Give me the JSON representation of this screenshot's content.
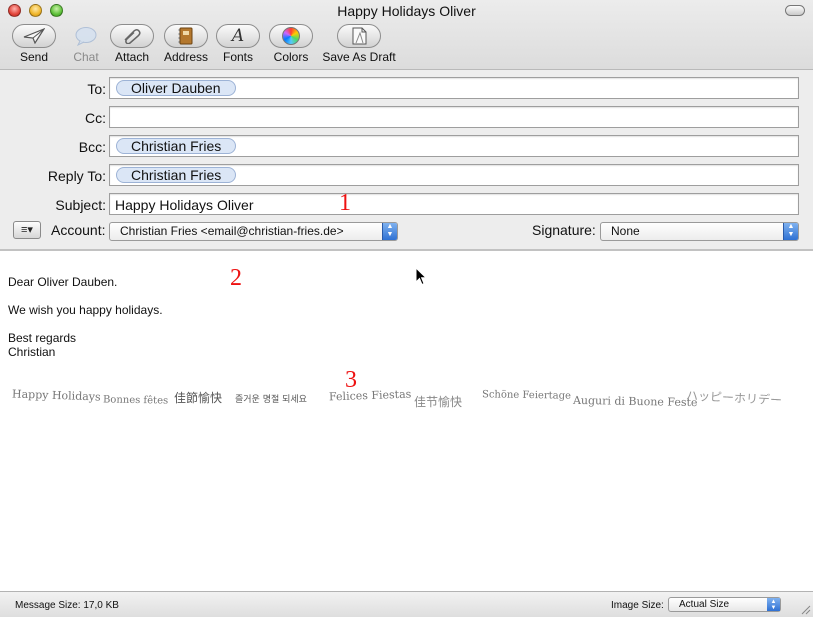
{
  "window": {
    "title": "Happy Holidays Oliver"
  },
  "toolbar": {
    "items": [
      {
        "label": "Send",
        "icon": "send-icon"
      },
      {
        "label": "Chat",
        "icon": "chat-icon"
      },
      {
        "label": "Attach",
        "icon": "paperclip-icon"
      },
      {
        "label": "Address",
        "icon": "address-book-icon"
      },
      {
        "label": "Fonts",
        "icon": "fonts-icon"
      },
      {
        "label": "Colors",
        "icon": "color-wheel-icon"
      },
      {
        "label": "Save As Draft",
        "icon": "draft-icon"
      }
    ]
  },
  "fields": {
    "to": {
      "label": "To:",
      "tokens": [
        "Oliver Dauben"
      ]
    },
    "cc": {
      "label": "Cc:",
      "tokens": []
    },
    "bcc": {
      "label": "Bcc:",
      "tokens": [
        "Christian Fries"
      ]
    },
    "reply_to": {
      "label": "Reply To:",
      "tokens": [
        "Christian Fries"
      ]
    },
    "subject": {
      "label": "Subject:",
      "value": "Happy Holidays Oliver"
    },
    "account": {
      "label": "Account:",
      "value": "Christian Fries <email@christian-fries.de>"
    },
    "signature": {
      "label": "Signature:",
      "value": "None"
    }
  },
  "message": {
    "lines": [
      "Dear Oliver Dauben.",
      "We wish you happy holidays.",
      "Best regards",
      "Christian"
    ],
    "greetings": [
      "Happy Holidays",
      "Bonnes fêtes",
      "佳節愉快",
      "즐거운 명절 되세요",
      "Felices Fiestas",
      "佳节愉快",
      "Schöne Feiertage",
      "Auguri di Buone Feste",
      "ハッピーホリデー"
    ]
  },
  "annotations": [
    "1",
    "2",
    "3"
  ],
  "status": {
    "message_size": "Message Size: 17,0 KB",
    "image_size_label": "Image Size:",
    "image_size_value": "Actual Size"
  },
  "colors": {
    "annotation": "#ee1111",
    "token_fill": "#dbe6f6",
    "popup_accent": "#2f71d3"
  }
}
